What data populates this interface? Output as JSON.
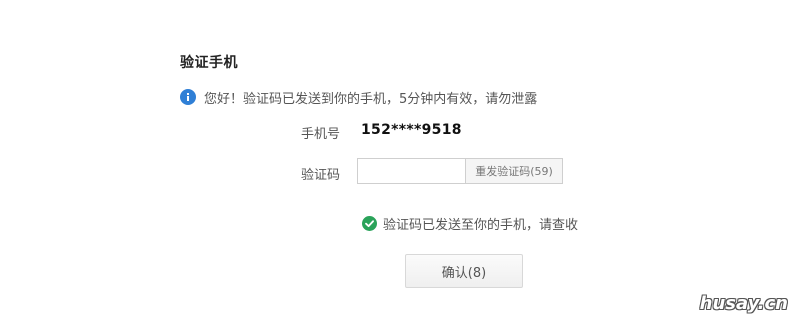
{
  "page": {
    "title": "验证手机",
    "notice": "您好！验证码已发送到你的手机，5分钟内有效，请勿泄露",
    "info_icon": "info-icon"
  },
  "form": {
    "phone_label": "手机号",
    "phone_value": "152****9518",
    "code_label": "验证码",
    "code_value": "",
    "code_placeholder": "",
    "resend_label": "重发验证码(59)"
  },
  "status": {
    "icon": "check-circle-icon",
    "message": "验证码已发送至你的手机，请查收",
    "color": "#2aa35a"
  },
  "actions": {
    "confirm_label": "确认(8)"
  },
  "watermark": {
    "text": "husay.cn"
  },
  "colors": {
    "info": "#2f7fd6",
    "success": "#2aa35a"
  }
}
